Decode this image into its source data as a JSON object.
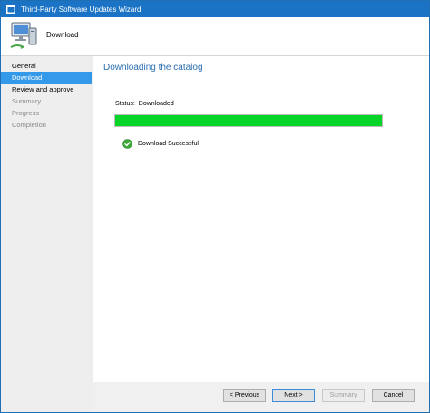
{
  "window": {
    "title": "Third-Party Software Updates Wizard"
  },
  "header": {
    "heading": "Download",
    "icon": "computer-monitor-icon"
  },
  "sidebar": {
    "items": [
      {
        "label": "General",
        "state": "normal"
      },
      {
        "label": "Download",
        "state": "active"
      },
      {
        "label": "Review and approve",
        "state": "normal"
      },
      {
        "label": "Summary",
        "state": "disabled"
      },
      {
        "label": "Progress",
        "state": "disabled"
      },
      {
        "label": "Completion",
        "state": "disabled"
      }
    ]
  },
  "main": {
    "title": "Downloading the catalog",
    "status_label": "Status:",
    "status_value": "Downloaded",
    "progress_fraction": 1.0,
    "result_text": "Download Successful",
    "result_icon": "success-check-icon"
  },
  "footer": {
    "previous_label": "< Previous",
    "next_label": "Next >",
    "summary_label": "Summary",
    "cancel_label": "Cancel"
  },
  "colors": {
    "titlebar": "#1a73c4",
    "accent_title": "#2b6fb3",
    "active_nav": "#3399e8",
    "progress": "#06d426",
    "success": "#3ea83a"
  }
}
